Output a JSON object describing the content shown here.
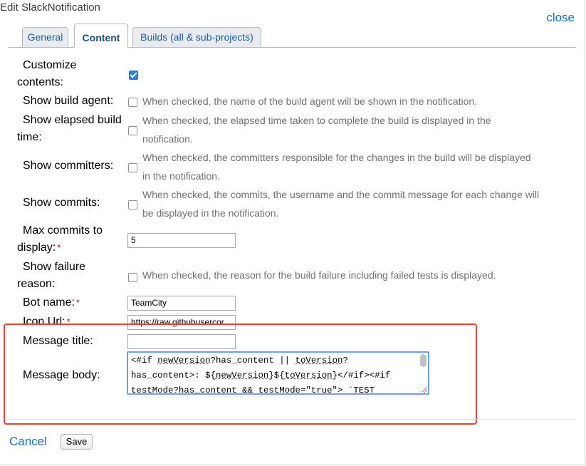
{
  "dialog": {
    "title": "Edit SlackNotification",
    "close_label": "close"
  },
  "tabs": [
    {
      "label": "General",
      "active": false
    },
    {
      "label": "Content",
      "active": true
    },
    {
      "label": "Builds (all & sub-projects)",
      "active": false
    }
  ],
  "form": {
    "customize_contents": {
      "label_line1": "Customize",
      "label_line2": "contents:",
      "checked": true
    },
    "show_build_agent": {
      "label": "Show build agent:",
      "checked": false,
      "description": "When checked, the name of the build agent will be shown in the notification."
    },
    "show_elapsed_build_time": {
      "label_line1": "Show elapsed build",
      "label_line2": "time:",
      "checked": false,
      "description_line1": "When checked, the elapsed time taken to complete the build is displayed in the",
      "description_line2": "notification."
    },
    "show_committers": {
      "label": "Show committers:",
      "checked": false,
      "description_line1": "When checked, the committers responsible for the changes in the build will be displayed",
      "description_line2": "in the notification."
    },
    "show_commits": {
      "label": "Show commits:",
      "checked": false,
      "description_line1": "When checked, the commits, the username and the commit message for each change will",
      "description_line2": "be displayed in the notification."
    },
    "max_commits": {
      "label_line1": "Max commits to",
      "label_line2": "display:",
      "required_mark": "*",
      "value": "5"
    },
    "show_failure_reason": {
      "label_line1": "Show failure",
      "label_line2": "reason:",
      "checked": false,
      "description": "When checked, the reason for the build failure including failed tests is displayed."
    },
    "bot_name": {
      "label": "Bot name:",
      "required_mark": "*",
      "value": "TeamCity"
    },
    "icon_url": {
      "label": "Icon Url:",
      "required_mark": "*",
      "value": "https://raw.githubusercor"
    },
    "message_title": {
      "label": "Message title:",
      "value": ""
    },
    "message_body": {
      "label": "Message body:",
      "value_line1_a": "<#if ",
      "value_line1_b": "newVersion",
      "value_line1_c": "?has_content || ",
      "value_line1_d": "toVersion",
      "value_line1_e": "?",
      "value_line2_a": "has_content>: ${",
      "value_line2_b": "newVersion",
      "value_line2_c": "}${",
      "value_line2_d": "toVersion",
      "value_line2_e": "}</#if><#if",
      "value_line3": "testMode?has_content && testMode=\"true\"> `TEST"
    }
  },
  "footer": {
    "cancel_label": "Cancel",
    "save_label": "Save"
  },
  "colors": {
    "link": "#1a6fc4",
    "highlight_border": "#e0443a",
    "checkbox_checked": "#2f7de1",
    "required": "#d0021b"
  }
}
